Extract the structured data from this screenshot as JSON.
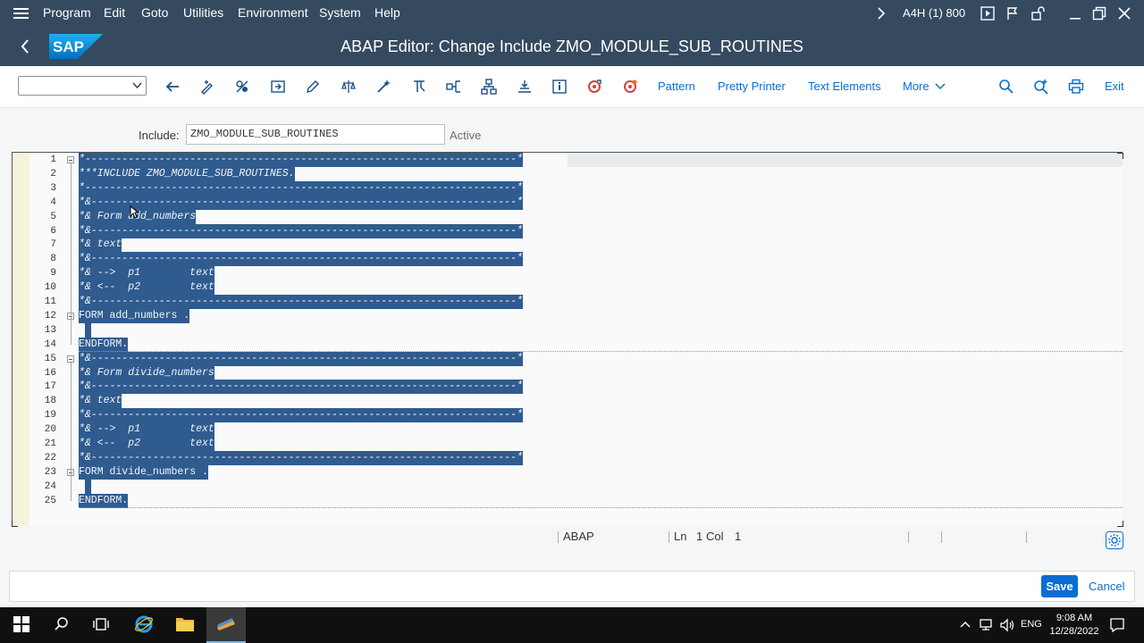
{
  "menubar": {
    "items": [
      "Program",
      "Edit",
      "Goto",
      "Utilities",
      "Environment",
      "System",
      "Help"
    ],
    "system_info": "A4H (1) 800"
  },
  "titlebar": {
    "title": "ABAP Editor: Change Include ZMO_MODULE_SUB_ROUTINES",
    "logo_text": "SAP"
  },
  "toolbar": {
    "command_field_value": "",
    "buttons": {
      "pattern": "Pattern",
      "pretty_printer": "Pretty Printer",
      "text_elements": "Text Elements",
      "more": "More",
      "exit": "Exit"
    }
  },
  "include": {
    "label": "Include:",
    "value": "ZMO_MODULE_SUB_ROUTINES",
    "status": "Active"
  },
  "editor": {
    "lines": [
      "*----------------------------------------------------------------------*",
      "***INCLUDE ZMO_MODULE_SUB_ROUTINES.",
      "*----------------------------------------------------------------------*",
      "*&---------------------------------------------------------------------*",
      "*& Form add_numbers",
      "*&---------------------------------------------------------------------*",
      "*& text",
      "*&---------------------------------------------------------------------*",
      "*& -->  p1        text",
      "*& <--  p2        text",
      "*&---------------------------------------------------------------------*",
      "FORM add_numbers .",
      "",
      "ENDFORM.",
      "*&---------------------------------------------------------------------*",
      "*& Form divide_numbers",
      "*&---------------------------------------------------------------------*",
      "*& text",
      "*&---------------------------------------------------------------------*",
      "*& -->  p1        text",
      "*& <--  p2        text",
      "*&---------------------------------------------------------------------*",
      "FORM divide_numbers .",
      "",
      "ENDFORM."
    ]
  },
  "status_bar": {
    "language": "ABAP",
    "ln_label": "Ln",
    "ln_value": "1",
    "col_label": "Col",
    "col_value": "1"
  },
  "footer": {
    "save_label": "Save",
    "cancel_label": "Cancel"
  },
  "taskbar": {
    "language": "ENG",
    "time": "9:08 AM",
    "date": "12/28/2022"
  },
  "colors": {
    "shell_header": "#354a5f",
    "selection": "#2f5b8f",
    "link_blue": "#0a6ed1"
  }
}
